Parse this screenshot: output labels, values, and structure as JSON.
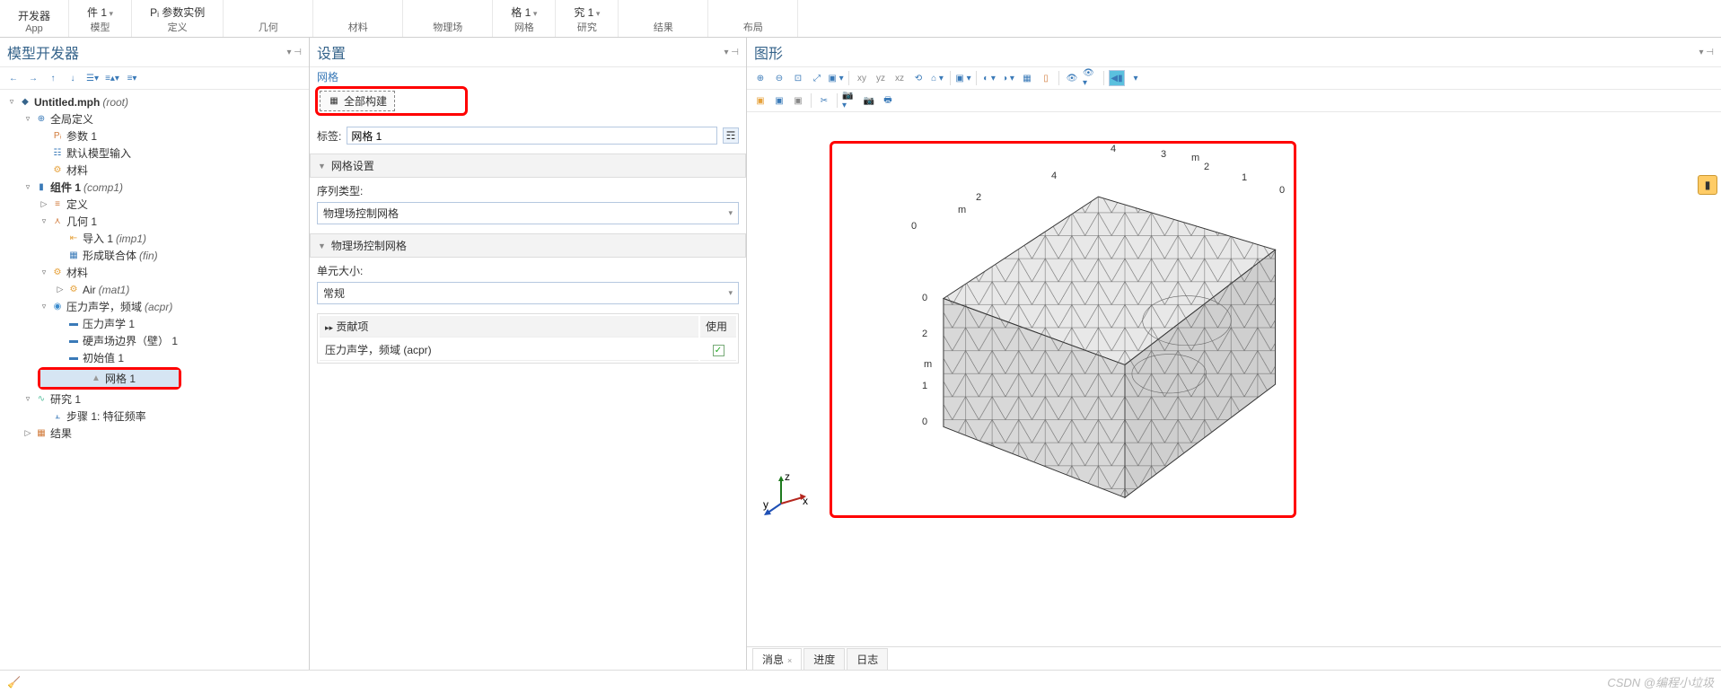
{
  "ribbon": {
    "groups": [
      {
        "top": "开发器",
        "label": "App"
      },
      {
        "top": "件 1",
        "label": "模型",
        "dd": true
      },
      {
        "top": "Pᵢ 参数实例",
        "label": "定义",
        "faded": true
      },
      {
        "top": "",
        "label": "几何"
      },
      {
        "top": "",
        "label": "材料"
      },
      {
        "top": "",
        "label": "物理场"
      },
      {
        "top": "格 1",
        "label": "网格",
        "dd": true
      },
      {
        "top": "究 1",
        "label": "研究",
        "dd": true
      },
      {
        "top": "",
        "label": "结果"
      },
      {
        "top": "",
        "label": "布局"
      }
    ]
  },
  "model_builder": {
    "title": "模型开发器",
    "tree": [
      {
        "level": 0,
        "exp": "▿",
        "icon": "◆",
        "iconColor": "#36648B",
        "label": "Untitled.mph",
        "suffix": "(root)",
        "bold": true
      },
      {
        "level": 1,
        "exp": "▿",
        "icon": "⊕",
        "iconColor": "#3a7ab8",
        "label": "全局定义"
      },
      {
        "level": 2,
        "exp": "",
        "icon": "Pᵢ",
        "iconColor": "#d17a3a",
        "label": "参数 1"
      },
      {
        "level": 2,
        "exp": "",
        "icon": "☷",
        "iconColor": "#3a7ab8",
        "label": "默认模型输入"
      },
      {
        "level": 2,
        "exp": "",
        "icon": "⚙",
        "iconColor": "#e6a23c",
        "label": "材料"
      },
      {
        "level": 1,
        "exp": "▿",
        "icon": "▮",
        "iconColor": "#3a7ab8",
        "label": "组件 1",
        "suffix": "(comp1)",
        "bold": true
      },
      {
        "level": 2,
        "exp": "▷",
        "icon": "≡",
        "iconColor": "#d17a3a",
        "label": "定义"
      },
      {
        "level": 2,
        "exp": "▿",
        "icon": "⋏",
        "iconColor": "#d17a3a",
        "label": "几何 1"
      },
      {
        "level": 3,
        "exp": "",
        "icon": "⇤",
        "iconColor": "#e6a23c",
        "label": "导入 1",
        "suffix": "(imp1)"
      },
      {
        "level": 3,
        "exp": "",
        "icon": "▦",
        "iconColor": "#3a7ab8",
        "label": "形成联合体",
        "suffix": "(fin)"
      },
      {
        "level": 2,
        "exp": "▿",
        "icon": "⚙",
        "iconColor": "#e6a23c",
        "label": "材料"
      },
      {
        "level": 3,
        "exp": "▷",
        "icon": "⚙",
        "iconColor": "#e6a23c",
        "label": "Air",
        "suffix": "(mat1)"
      },
      {
        "level": 2,
        "exp": "▿",
        "icon": "◉",
        "iconColor": "#3a8bcd",
        "label": "压力声学，频域",
        "suffix": "(acpr)"
      },
      {
        "level": 3,
        "exp": "",
        "icon": "▬",
        "iconColor": "#3a7ab8",
        "label": "压力声学 1"
      },
      {
        "level": 3,
        "exp": "",
        "icon": "▬",
        "iconColor": "#3a7ab8",
        "label": "硬声场边界（壁） 1"
      },
      {
        "level": 3,
        "exp": "",
        "icon": "▬",
        "iconColor": "#3a7ab8",
        "label": "初始值 1"
      },
      {
        "level": 2,
        "exp": "",
        "icon": "▲",
        "iconColor": "#999",
        "label": "网格 1",
        "selected": true,
        "redbox": true
      },
      {
        "level": 1,
        "exp": "▿",
        "icon": "∿",
        "iconColor": "#5bc0a0",
        "label": "研究 1"
      },
      {
        "level": 2,
        "exp": "",
        "icon": "⫠",
        "iconColor": "#3a7ab8",
        "label": "步骤 1: 特征频率"
      },
      {
        "level": 1,
        "exp": "▷",
        "icon": "▦",
        "iconColor": "#d17a3a",
        "label": "结果"
      }
    ]
  },
  "settings": {
    "title": "设置",
    "crumb": "网格",
    "build_all": "全部构建",
    "label_field": "标签:",
    "label_value": "网格 1",
    "mesh_settings": "网格设置",
    "seq_type": "序列类型:",
    "seq_value": "物理场控制网格",
    "phys_ctrl": "物理场控制网格",
    "elem_size": "单元大小:",
    "elem_value": "常规",
    "contrib_hdr": "贡献项",
    "use_hdr": "使用",
    "contrib_row": "压力声学，频域 (acpr)"
  },
  "graphics": {
    "title": "图形",
    "axis_ticks_top": [
      "4",
      "3",
      "2",
      "1",
      "0"
    ],
    "axis_ticks_left": [
      "0",
      "2",
      "m",
      "1",
      "0"
    ],
    "axis_label_top": "m",
    "axis_label_left": "m",
    "axes3d": {
      "x": "x",
      "y": "y",
      "z": "z"
    }
  },
  "bottom_tabs": {
    "messages": "消息",
    "progress": "进度",
    "log": "日志"
  },
  "status": {
    "watermark": "CSDN @编程小垃圾"
  }
}
